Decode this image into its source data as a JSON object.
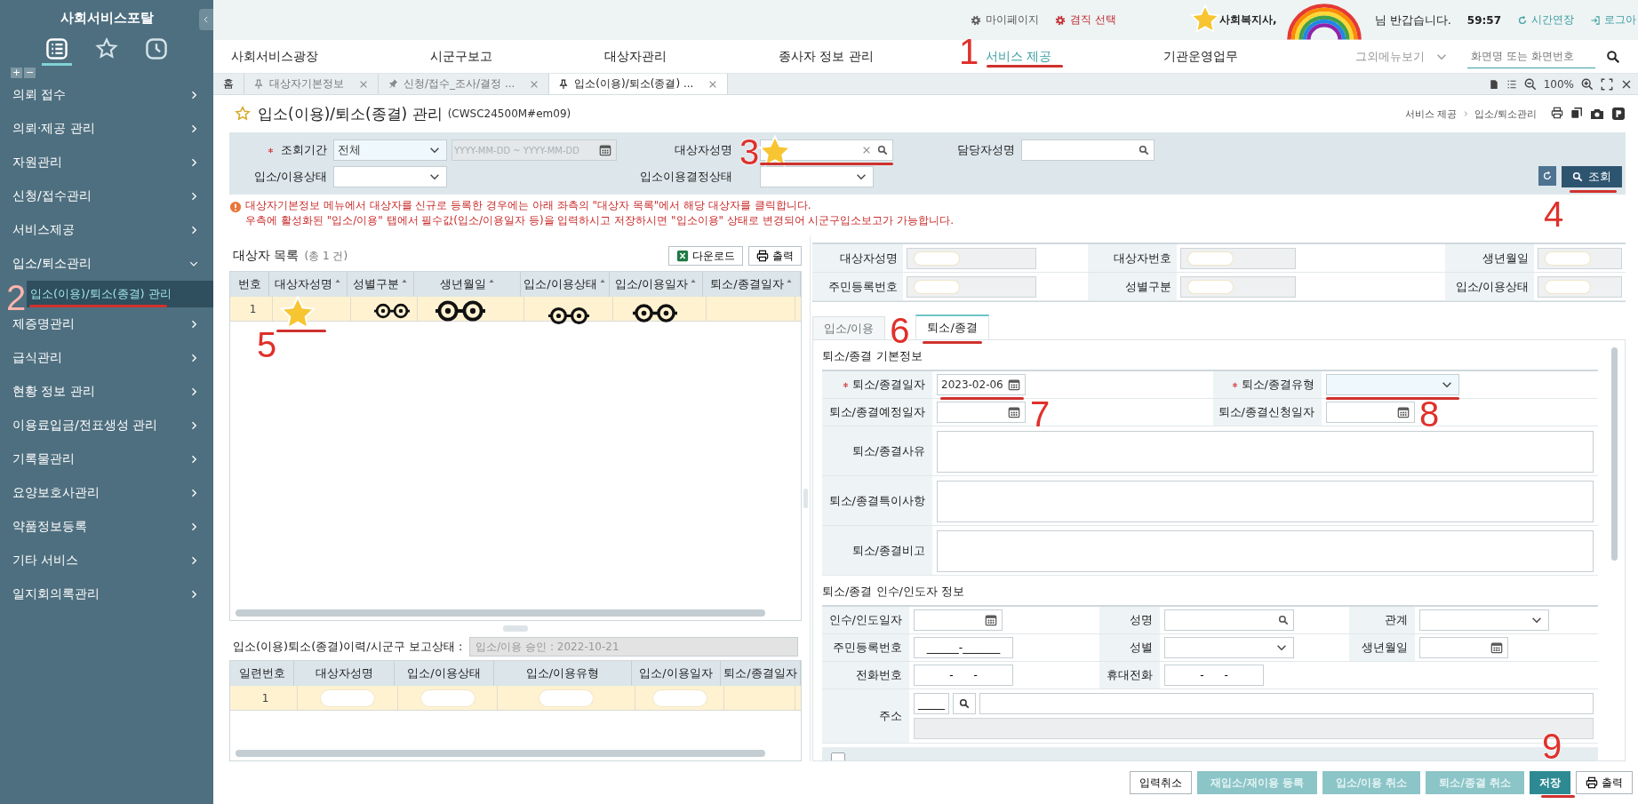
{
  "sidebar": {
    "title": "사회서비스포탈",
    "views": [
      {
        "kind": "menu",
        "selected": true
      },
      {
        "kind": "favorites",
        "selected": false
      },
      {
        "kind": "recent",
        "selected": false
      }
    ],
    "tree_buttons": [
      "+",
      "−"
    ],
    "items": [
      {
        "label": "의뢰 접수",
        "expanded": false
      },
      {
        "label": "의뢰·제공 관리",
        "expanded": false
      },
      {
        "label": "자원관리",
        "expanded": false
      },
      {
        "label": "신청/접수관리",
        "expanded": false
      },
      {
        "label": "서비스제공",
        "expanded": false
      },
      {
        "label": "입소/퇴소관리",
        "expanded": true,
        "children": [
          {
            "label": "입소(이용)/퇴소(종결) 관리",
            "selected": true
          }
        ]
      },
      {
        "label": "제증명관리",
        "expanded": false
      },
      {
        "label": "급식관리",
        "expanded": false
      },
      {
        "label": "현황 정보 관리",
        "expanded": false
      },
      {
        "label": "이용료입금/전표생성 관리",
        "expanded": false
      },
      {
        "label": "기록물관리",
        "expanded": false
      },
      {
        "label": "요양보호사관리",
        "expanded": false
      },
      {
        "label": "약품정보등록",
        "expanded": false
      },
      {
        "label": "기타 서비스",
        "expanded": false
      },
      {
        "label": "일지회의록관리",
        "expanded": false
      }
    ]
  },
  "top_bar": {
    "links": [
      {
        "label": "마이페이지",
        "emphasized": false
      },
      {
        "label": "겸직 선택",
        "emphasized": true
      }
    ],
    "user": "사회복지사,",
    "greeting": "님 반갑습니다.",
    "timer": "59:57",
    "actions": [
      {
        "kind": "extend",
        "label": "시간연장"
      },
      {
        "kind": "logout",
        "label": "로그아"
      }
    ]
  },
  "nav": {
    "items": [
      {
        "label": "사회서비스광장",
        "selected": false
      },
      {
        "label": "시군구보고",
        "selected": false
      },
      {
        "label": "대상자관리",
        "selected": false
      },
      {
        "label": "종사자 정보 관리",
        "selected": false
      },
      {
        "label": "서비스 제공",
        "selected": true
      },
      {
        "label": "기관운영업무",
        "selected": false
      }
    ],
    "more": "그외메뉴보기",
    "search": {
      "placeholder": "화면명 또는 화면번호"
    }
  },
  "tabs": {
    "items": [
      {
        "kind": "home",
        "label": "홈",
        "selected": false
      },
      {
        "kind": "pinned",
        "label": "대상자기본정보",
        "selected": false
      },
      {
        "kind": "unpinned",
        "label": "신청/접수_조사/결정 ...",
        "selected": false
      },
      {
        "kind": "pinned",
        "label": "입소(이용)/퇴소(종결) ...",
        "selected": true
      }
    ],
    "zoom": "100%"
  },
  "page": {
    "title": "입소(이용)/퇴소(종결) 관리",
    "code": "(CWSC24500M#em09)",
    "breadcrumb": [
      "서비스 제공",
      "입소/퇴소관리"
    ]
  },
  "search": {
    "rows": [
      [
        {
          "label": "조회기간",
          "required": true,
          "controls": [
            {
              "kind": "select",
              "value": "전체"
            },
            {
              "kind": "daterange",
              "placeholder": "YYYY-MM-DD ~ YYYY-MM-DD",
              "disabled": true
            }
          ]
        },
        {
          "label": "대상자성명",
          "required": false,
          "controls": [
            {
              "kind": "search",
              "clearable": true
            }
          ]
        },
        {
          "label": "담당자성명",
          "required": false,
          "controls": [
            {
              "kind": "search",
              "clearable": false
            }
          ]
        }
      ],
      [
        {
          "label": "입소/이용상태",
          "required": false,
          "controls": [
            {
              "kind": "select"
            }
          ]
        },
        {
          "label": "입소이용결정상태",
          "required": false,
          "controls": [
            {
              "kind": "select"
            }
          ]
        }
      ]
    ],
    "buttons": [
      {
        "kind": "reset"
      },
      {
        "kind": "search",
        "label": "조회"
      }
    ]
  },
  "notices": [
    "대상자기본정보 메뉴에서 대상자를 신규로 등록한 경우에는 아래 좌측의 \"대상자 목록\"에서 해당 대상자를 클릭합니다.",
    "우측에 활성화된 \"입소/이용\" 탭에서 필수값(입소/이용일자 등)을 입력하시고 저장하시면 \"입소이용\" 상태로 변경되어 시군구입소보고가 가능합니다."
  ],
  "subject_list": {
    "title": "대상자 목록",
    "count": "(총 1 건)",
    "buttons": [
      {
        "kind": "excel",
        "label": "다운로드"
      },
      {
        "kind": "print",
        "label": "출력"
      }
    ],
    "columns": [
      {
        "label": "번호",
        "sortable": false
      },
      {
        "label": "대상자성명",
        "sortable": true
      },
      {
        "label": "성별구분",
        "sortable": true
      },
      {
        "label": "생년월일",
        "sortable": true
      },
      {
        "label": "입소/이용상태",
        "sortable": true
      },
      {
        "label": "입소/이용일자",
        "sortable": true
      },
      {
        "label": "퇴소/종결일자",
        "sortable": true
      }
    ],
    "rows": [
      {
        "number": "1",
        "selected": true
      }
    ]
  },
  "history": {
    "label": "입소(이용)퇴소(종결)이력/시군구 보고상태 :",
    "status": "입소/이용 승인 : 2022-10-21",
    "columns": [
      "일련번호",
      "대상자성명",
      "입소/이용상태",
      "입소/이용유형",
      "입소/이용일자",
      "퇴소/종결일자"
    ],
    "rows": [
      {
        "number": "1",
        "selected": true
      }
    ]
  },
  "detail": {
    "info": [
      {
        "label": "대상자성명"
      },
      {
        "label": "대상자번호"
      },
      {
        "label": "생년월일"
      },
      {
        "label": "주민등록번호"
      },
      {
        "label": "성별구분"
      },
      {
        "label": "입소/이용상태"
      }
    ],
    "tabs": [
      {
        "label": "입소/이용",
        "selected": false
      },
      {
        "label": "퇴소/종결",
        "selected": true
      }
    ],
    "sections": [
      {
        "title": "퇴소/종결 기본정보",
        "rows": [
          [
            {
              "label": "퇴소/종결일자",
              "required": true,
              "control": {
                "kind": "date",
                "value": "2023-02-06"
              }
            },
            {
              "label": "퇴소/종결유형",
              "required": true,
              "control": {
                "kind": "select"
              }
            }
          ],
          [
            {
              "label": "퇴소/종결예정일자",
              "required": false,
              "control": {
                "kind": "date"
              }
            },
            {
              "label": "퇴소/종결신청일자",
              "required": false,
              "control": {
                "kind": "date"
              }
            }
          ],
          [
            {
              "label": "퇴소/종결사유",
              "required": false,
              "control": {
                "kind": "textarea"
              }
            }
          ],
          [
            {
              "label": "퇴소/종결특이사항",
              "required": false,
              "control": {
                "kind": "textarea"
              }
            }
          ],
          [
            {
              "label": "퇴소/종결비고",
              "required": false,
              "control": {
                "kind": "textarea"
              }
            }
          ]
        ]
      },
      {
        "title": "퇴소/종결 인수/인도자 정보",
        "rows": [
          [
            {
              "label": "인수/인도일자",
              "required": false,
              "control": {
                "kind": "date"
              }
            },
            {
              "label": "성명",
              "required": false,
              "control": {
                "kind": "search"
              }
            },
            {
              "label": "관계",
              "required": false,
              "control": {
                "kind": "select"
              }
            }
          ],
          [
            {
              "label": "주민등록번호",
              "required": false,
              "control": {
                "kind": "masked",
                "value": "______-_______"
              }
            },
            {
              "label": "성별",
              "required": false,
              "control": {
                "kind": "select"
              }
            },
            {
              "label": "생년월일",
              "required": false,
              "control": {
                "kind": "date"
              }
            }
          ],
          [
            {
              "label": "전화번호",
              "required": false,
              "control": {
                "kind": "masked",
                "value": "-      -"
              }
            },
            {
              "label": "휴대전화",
              "required": false,
              "control": {
                "kind": "masked",
                "value": "-      -"
              }
            }
          ],
          [
            {
              "label": "주소",
              "required": false,
              "control": {
                "kind": "address",
                "value": "_____"
              }
            }
          ]
        ],
        "list_header": {
          "checked": false
        }
      }
    ]
  },
  "actions": [
    {
      "kind": "plain",
      "label": "입력취소",
      "disabled": false
    },
    {
      "kind": "action",
      "label": "재입소/재이용 등록",
      "disabled": true
    },
    {
      "kind": "action",
      "label": "입소/이용 취소",
      "disabled": true
    },
    {
      "kind": "action",
      "label": "퇴소/종결 취소",
      "disabled": true
    },
    {
      "kind": "primary",
      "label": "저장",
      "disabled": false
    },
    {
      "kind": "print",
      "label": "출력",
      "disabled": false
    }
  ],
  "annotations": [
    {
      "label": "1"
    },
    {
      "label": "2"
    },
    {
      "label": "3"
    },
    {
      "label": "4"
    },
    {
      "label": "5"
    },
    {
      "label": "6"
    },
    {
      "label": "7"
    },
    {
      "label": "8"
    },
    {
      "label": "9"
    }
  ]
}
